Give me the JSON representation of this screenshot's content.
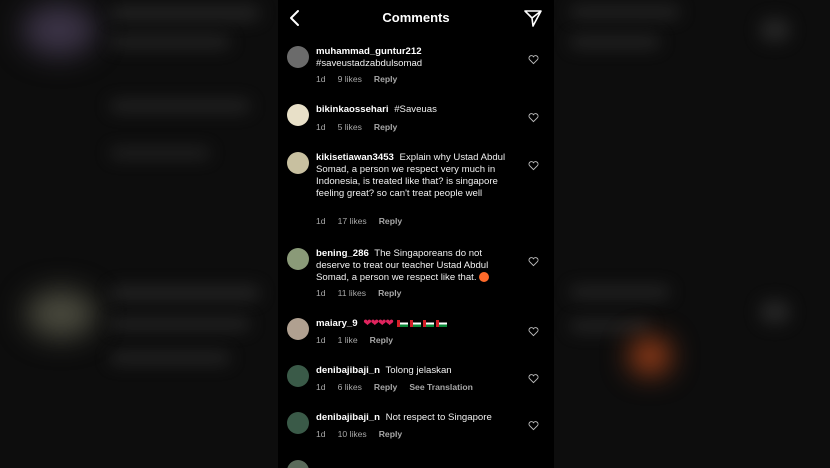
{
  "header": {
    "title": "Comments",
    "back_icon": "chevron-left-icon",
    "send_icon": "send-icon"
  },
  "comments": [
    {
      "user": "muhammad_guntur212",
      "text": "#saveustadzabdulsomad",
      "time": "1d",
      "likes": "9 likes",
      "reply": "Reply",
      "avatar_color": "#6b6b6b"
    },
    {
      "user": "bikinkaossehari",
      "text": "#Saveuas",
      "time": "1d",
      "likes": "5 likes",
      "reply": "Reply",
      "avatar_color": "#e8e0c8"
    },
    {
      "user": "kikisetiawan3453",
      "text": "Explain why Ustad Abdul Somad, a person we respect very much in Indonesia, is treated like that? is singapore feeling great? so can't treat people well",
      "time": "1d",
      "likes": "17 likes",
      "reply": "Reply",
      "avatar_color": "#c8c0a0"
    },
    {
      "user": "bening_286",
      "text": "The Singaporeans do not deserve to treat our teacher Ustad Abdul Somad, a person we respect like that.",
      "time": "1d",
      "likes": "11 likes",
      "reply": "Reply",
      "avatar_color": "#8a9a78"
    },
    {
      "user": "maiary_9",
      "text": "",
      "time": "1d",
      "likes": "1 like",
      "reply": "Reply",
      "avatar_color": "#b0a090"
    },
    {
      "user": "denibajibaji_n",
      "text": "Tolong jelaskan",
      "time": "1d",
      "likes": "6 likes",
      "reply": "Reply",
      "translate": "See Translation",
      "avatar_color": "#3a5a48"
    },
    {
      "user": "denibajibaji_n",
      "text": "Not respect to Singapore",
      "time": "1d",
      "likes": "10 likes",
      "reply": "Reply",
      "avatar_color": "#3a5a48"
    }
  ],
  "colors": {
    "background": "#000000",
    "text": "#f0f0f0",
    "meta": "#a8a8a8",
    "heart_emoji": "#e0245e"
  }
}
